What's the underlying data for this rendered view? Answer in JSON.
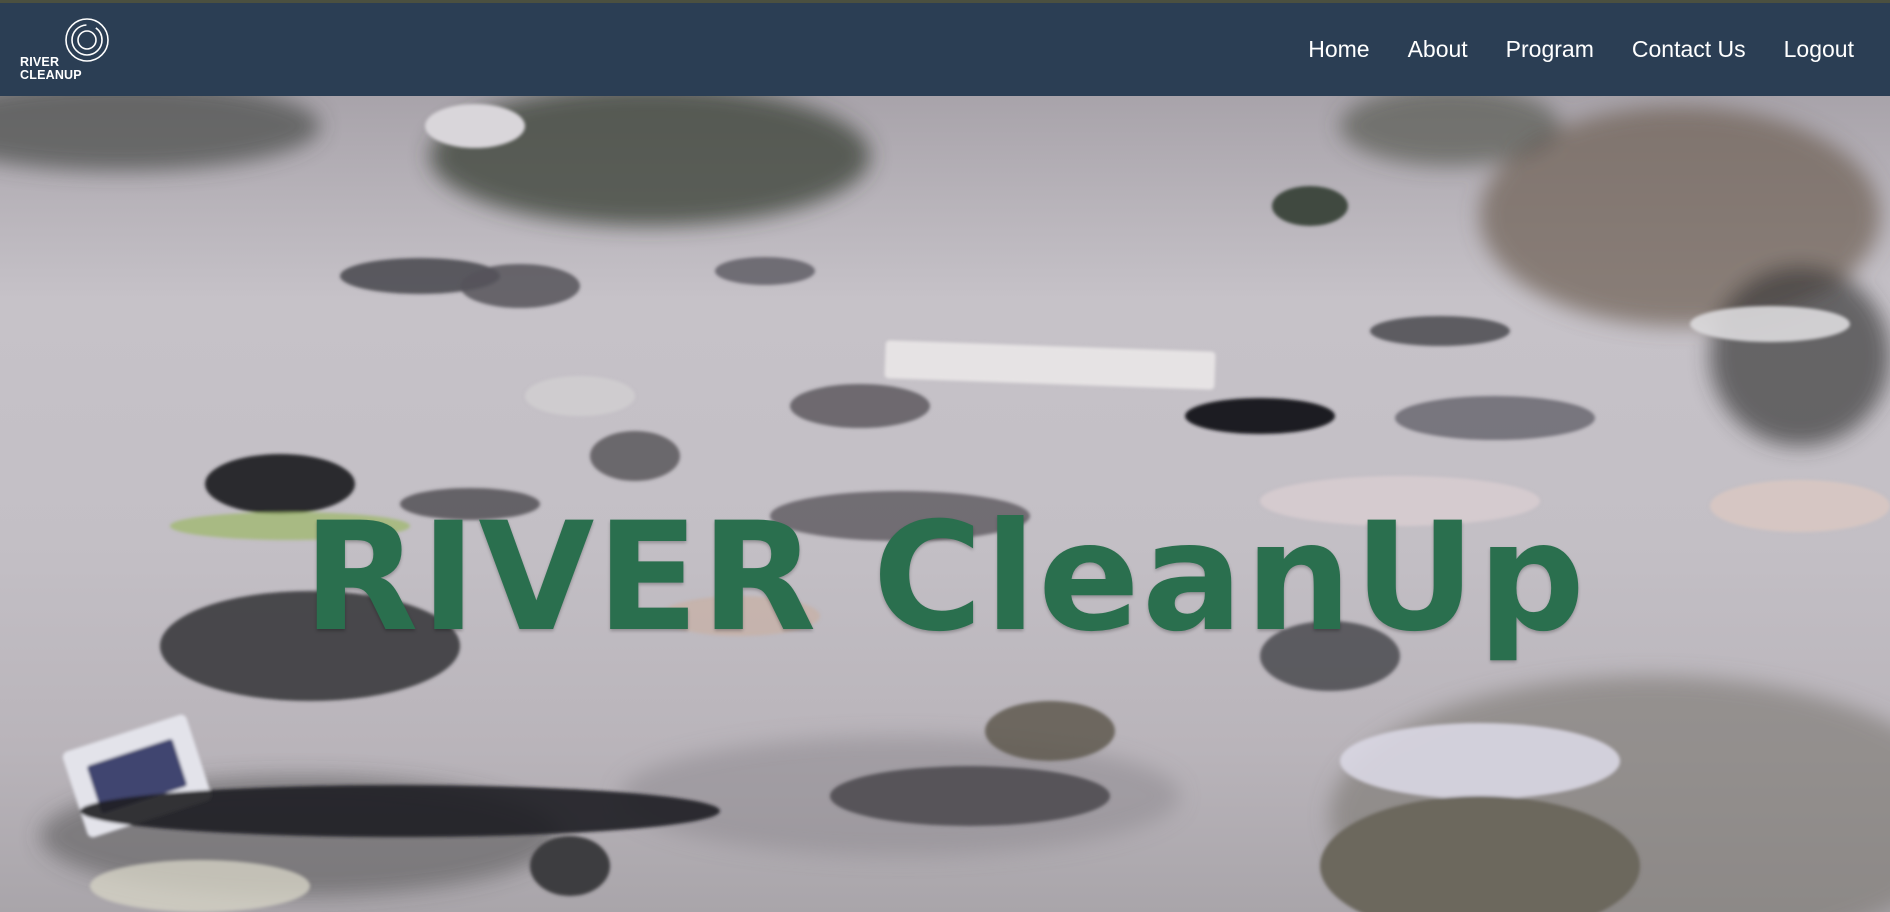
{
  "header": {
    "logo": {
      "line1": "RIVER",
      "line2": "CLEANUP"
    },
    "nav": [
      {
        "label": "Home"
      },
      {
        "label": "About"
      },
      {
        "label": "Program"
      },
      {
        "label": "Contact Us"
      },
      {
        "label": "Logout"
      }
    ]
  },
  "hero": {
    "title": "RIVER CleanUp",
    "background": "photo-of-polluted-river-with-floating-trash"
  },
  "colors": {
    "navbar": "#2b3e54",
    "title": "#2a6f4e",
    "nav_text": "#ffffff"
  }
}
